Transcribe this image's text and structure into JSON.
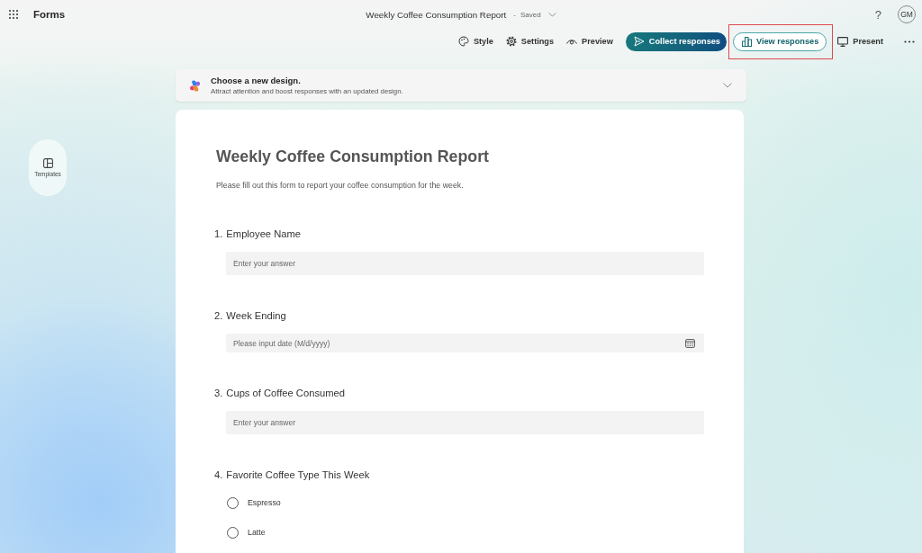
{
  "app_bar": {
    "app_name": "Forms",
    "document_title": "Weekly Coffee Consumption Report",
    "title_separator": "-",
    "save_status": "Saved",
    "help_label": "?",
    "avatar_initials": "GM"
  },
  "toolbar": [
    {
      "kind": "plain",
      "label": "Style",
      "highlighted": false
    },
    {
      "kind": "plain",
      "label": "Settings",
      "highlighted": false
    },
    {
      "kind": "plain",
      "label": "Preview",
      "highlighted": false
    },
    {
      "kind": "primary",
      "label": "Collect responses",
      "highlighted": false
    },
    {
      "kind": "outline",
      "label": "View responses",
      "highlighted": true
    },
    {
      "kind": "plain",
      "label": "Present",
      "highlighted": false
    }
  ],
  "side_rail": [
    {
      "label": "Templates"
    }
  ],
  "banner": {
    "title": "Choose a new design.",
    "subtitle": "Attract attention and boost responses with an updated design."
  },
  "form": {
    "title": "Weekly Coffee Consumption Report",
    "description": "Please fill out this form to report your coffee consumption for the week.",
    "questions": [
      {
        "number": "1.",
        "title": "Employee Name",
        "kind": "text",
        "placeholder": "Enter your answer"
      },
      {
        "number": "2.",
        "title": "Week Ending",
        "kind": "date",
        "placeholder": "Please input date (M/d/yyyy)"
      },
      {
        "number": "3.",
        "title": "Cups of Coffee Consumed",
        "kind": "text",
        "placeholder": "Enter your answer"
      },
      {
        "number": "4.",
        "title": "Favorite Coffee Type This Week",
        "kind": "choice",
        "options": [
          {
            "label": "Espresso",
            "selected": false
          },
          {
            "label": "Latte",
            "selected": false
          }
        ]
      }
    ]
  }
}
